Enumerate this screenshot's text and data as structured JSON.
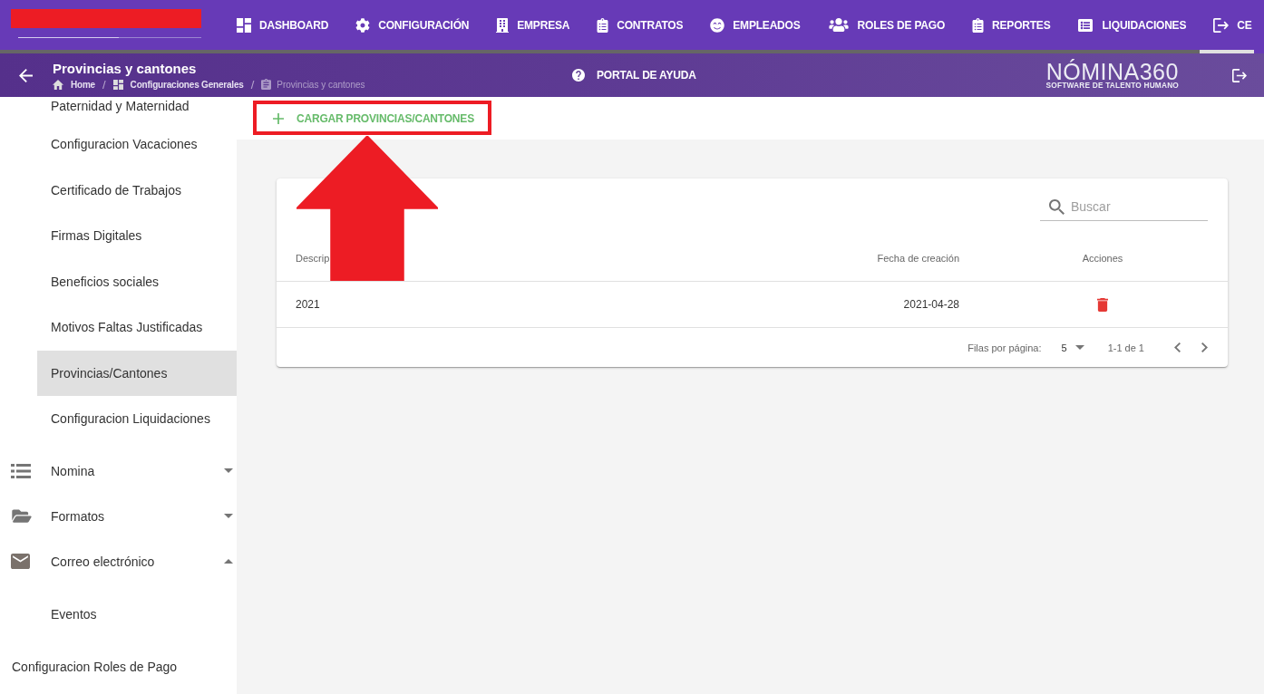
{
  "nav_tabs": [
    {
      "label": "DASHBOARD",
      "selected": false
    },
    {
      "label": "CONFIGURACIÓN",
      "selected": false
    },
    {
      "label": "EMPRESA",
      "selected": false
    },
    {
      "label": "CONTRATOS",
      "selected": false
    },
    {
      "label": "EMPLEADOS",
      "selected": false
    },
    {
      "label": "ROLES DE PAGO",
      "selected": false
    },
    {
      "label": "REPORTES",
      "selected": false
    },
    {
      "label": "LIQUIDACIONES",
      "selected": false
    },
    {
      "label": "CE",
      "selected": true
    }
  ],
  "page_header": {
    "title": "Provincias y cantones",
    "breadcrumbs": [
      {
        "kind": "link",
        "label": "Home"
      },
      {
        "kind": "separator",
        "label": "/"
      },
      {
        "kind": "link",
        "label": "Configuraciones Generales"
      },
      {
        "kind": "separator",
        "label": "/"
      },
      {
        "kind": "current",
        "label": "Provincias y cantones"
      }
    ],
    "help_link": "PORTAL DE AYUDA",
    "brand": {
      "name": "NÓMINA360",
      "tagline": "SOFTWARE DE TALENTO HUMANO"
    }
  },
  "sidebar": {
    "section_items": [
      {
        "label": "Paternidad y Maternidad",
        "selected": false
      },
      {
        "label": "Configuracion Vacaciones",
        "selected": false
      },
      {
        "label": "Certificado de Trabajos",
        "selected": false
      },
      {
        "label": "Firmas Digitales",
        "selected": false
      },
      {
        "label": "Beneficios sociales",
        "selected": false
      },
      {
        "label": "Motivos Faltas Justificadas",
        "selected": false
      },
      {
        "label": "Provincias/Cantones",
        "selected": true
      },
      {
        "label": "Configuracion Liquidaciones",
        "selected": false
      }
    ],
    "items": [
      {
        "kind": "group",
        "label": "Nomina",
        "expanded": false,
        "selected": false
      },
      {
        "kind": "group",
        "label": "Formatos",
        "expanded": false,
        "selected": false
      },
      {
        "kind": "group",
        "label": "Correo electrónico",
        "expanded": true,
        "selected": false,
        "children": [
          {
            "label": "Eventos",
            "selected": false
          }
        ]
      },
      {
        "kind": "link",
        "label": "Configuracion Roles de Pago",
        "selected": false
      }
    ]
  },
  "toolbar": {
    "upload_button": "CARGAR PROVINCIAS/CANTONES"
  },
  "table": {
    "search": {
      "placeholder": "Buscar"
    },
    "columns": [
      "Descrip",
      "Fecha de creación",
      "Acciones"
    ],
    "rows": [
      {
        "description": "2021",
        "created": "2021-04-28"
      }
    ],
    "pagination": {
      "rows_per_page_label": "Filas por página:",
      "rows_per_page": "5",
      "range": "1-1 de 1"
    }
  }
}
